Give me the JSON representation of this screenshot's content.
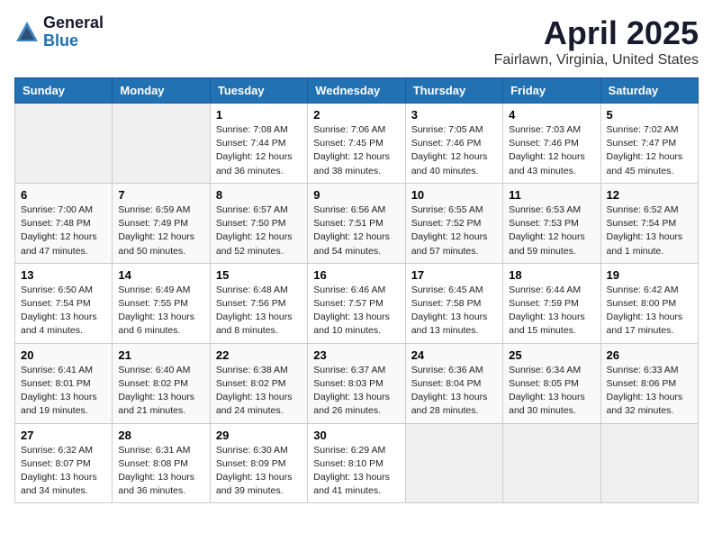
{
  "logo": {
    "general": "General",
    "blue": "Blue"
  },
  "title": "April 2025",
  "subtitle": "Fairlawn, Virginia, United States",
  "days_of_week": [
    "Sunday",
    "Monday",
    "Tuesday",
    "Wednesday",
    "Thursday",
    "Friday",
    "Saturday"
  ],
  "weeks": [
    [
      {
        "num": "",
        "info": "",
        "empty": true
      },
      {
        "num": "",
        "info": "",
        "empty": true
      },
      {
        "num": "1",
        "info": "Sunrise: 7:08 AM\nSunset: 7:44 PM\nDaylight: 12 hours\nand 36 minutes."
      },
      {
        "num": "2",
        "info": "Sunrise: 7:06 AM\nSunset: 7:45 PM\nDaylight: 12 hours\nand 38 minutes."
      },
      {
        "num": "3",
        "info": "Sunrise: 7:05 AM\nSunset: 7:46 PM\nDaylight: 12 hours\nand 40 minutes."
      },
      {
        "num": "4",
        "info": "Sunrise: 7:03 AM\nSunset: 7:46 PM\nDaylight: 12 hours\nand 43 minutes."
      },
      {
        "num": "5",
        "info": "Sunrise: 7:02 AM\nSunset: 7:47 PM\nDaylight: 12 hours\nand 45 minutes."
      }
    ],
    [
      {
        "num": "6",
        "info": "Sunrise: 7:00 AM\nSunset: 7:48 PM\nDaylight: 12 hours\nand 47 minutes."
      },
      {
        "num": "7",
        "info": "Sunrise: 6:59 AM\nSunset: 7:49 PM\nDaylight: 12 hours\nand 50 minutes."
      },
      {
        "num": "8",
        "info": "Sunrise: 6:57 AM\nSunset: 7:50 PM\nDaylight: 12 hours\nand 52 minutes."
      },
      {
        "num": "9",
        "info": "Sunrise: 6:56 AM\nSunset: 7:51 PM\nDaylight: 12 hours\nand 54 minutes."
      },
      {
        "num": "10",
        "info": "Sunrise: 6:55 AM\nSunset: 7:52 PM\nDaylight: 12 hours\nand 57 minutes."
      },
      {
        "num": "11",
        "info": "Sunrise: 6:53 AM\nSunset: 7:53 PM\nDaylight: 12 hours\nand 59 minutes."
      },
      {
        "num": "12",
        "info": "Sunrise: 6:52 AM\nSunset: 7:54 PM\nDaylight: 13 hours\nand 1 minute."
      }
    ],
    [
      {
        "num": "13",
        "info": "Sunrise: 6:50 AM\nSunset: 7:54 PM\nDaylight: 13 hours\nand 4 minutes."
      },
      {
        "num": "14",
        "info": "Sunrise: 6:49 AM\nSunset: 7:55 PM\nDaylight: 13 hours\nand 6 minutes."
      },
      {
        "num": "15",
        "info": "Sunrise: 6:48 AM\nSunset: 7:56 PM\nDaylight: 13 hours\nand 8 minutes."
      },
      {
        "num": "16",
        "info": "Sunrise: 6:46 AM\nSunset: 7:57 PM\nDaylight: 13 hours\nand 10 minutes."
      },
      {
        "num": "17",
        "info": "Sunrise: 6:45 AM\nSunset: 7:58 PM\nDaylight: 13 hours\nand 13 minutes."
      },
      {
        "num": "18",
        "info": "Sunrise: 6:44 AM\nSunset: 7:59 PM\nDaylight: 13 hours\nand 15 minutes."
      },
      {
        "num": "19",
        "info": "Sunrise: 6:42 AM\nSunset: 8:00 PM\nDaylight: 13 hours\nand 17 minutes."
      }
    ],
    [
      {
        "num": "20",
        "info": "Sunrise: 6:41 AM\nSunset: 8:01 PM\nDaylight: 13 hours\nand 19 minutes."
      },
      {
        "num": "21",
        "info": "Sunrise: 6:40 AM\nSunset: 8:02 PM\nDaylight: 13 hours\nand 21 minutes."
      },
      {
        "num": "22",
        "info": "Sunrise: 6:38 AM\nSunset: 8:02 PM\nDaylight: 13 hours\nand 24 minutes."
      },
      {
        "num": "23",
        "info": "Sunrise: 6:37 AM\nSunset: 8:03 PM\nDaylight: 13 hours\nand 26 minutes."
      },
      {
        "num": "24",
        "info": "Sunrise: 6:36 AM\nSunset: 8:04 PM\nDaylight: 13 hours\nand 28 minutes."
      },
      {
        "num": "25",
        "info": "Sunrise: 6:34 AM\nSunset: 8:05 PM\nDaylight: 13 hours\nand 30 minutes."
      },
      {
        "num": "26",
        "info": "Sunrise: 6:33 AM\nSunset: 8:06 PM\nDaylight: 13 hours\nand 32 minutes."
      }
    ],
    [
      {
        "num": "27",
        "info": "Sunrise: 6:32 AM\nSunset: 8:07 PM\nDaylight: 13 hours\nand 34 minutes."
      },
      {
        "num": "28",
        "info": "Sunrise: 6:31 AM\nSunset: 8:08 PM\nDaylight: 13 hours\nand 36 minutes."
      },
      {
        "num": "29",
        "info": "Sunrise: 6:30 AM\nSunset: 8:09 PM\nDaylight: 13 hours\nand 39 minutes."
      },
      {
        "num": "30",
        "info": "Sunrise: 6:29 AM\nSunset: 8:10 PM\nDaylight: 13 hours\nand 41 minutes."
      },
      {
        "num": "",
        "info": "",
        "empty": true
      },
      {
        "num": "",
        "info": "",
        "empty": true
      },
      {
        "num": "",
        "info": "",
        "empty": true
      }
    ]
  ]
}
